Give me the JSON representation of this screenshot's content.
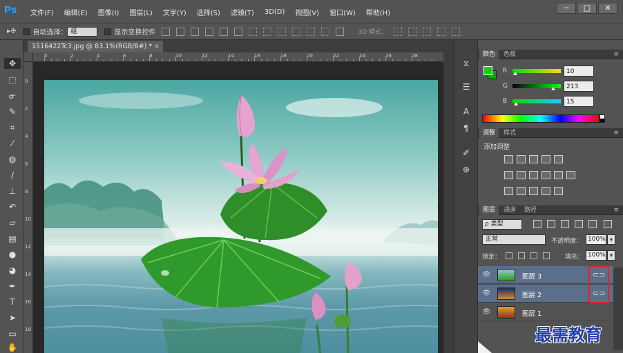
{
  "app": {
    "logo": "Ps"
  },
  "menu": [
    "文件(F)",
    "编辑(E)",
    "图像(I)",
    "图层(L)",
    "文字(Y)",
    "选择(S)",
    "滤镜(T)",
    "3D(D)",
    "视图(V)",
    "窗口(W)",
    "帮助(H)"
  ],
  "window_buttons": {
    "minimize": "−",
    "maximize": "□",
    "close": "✕"
  },
  "options": {
    "move_tool_glyph": "▸✣",
    "auto_select_label": "自动选择：",
    "auto_select_value": "组",
    "show_transform_label": "显示变换控件",
    "mode_3d_label": "3D 模式："
  },
  "document": {
    "tab_title": "1516422Tc3.jpg @ 83.1%(RGB/8#) *",
    "close": "×"
  },
  "ruler_top": [
    "0",
    "2",
    "4",
    "6",
    "8",
    "10",
    "12",
    "14",
    "16",
    "18",
    "20",
    "22",
    "24",
    "26",
    "28"
  ],
  "ruler_left": [
    "0",
    "2",
    "4",
    "6",
    "8",
    "10",
    "12",
    "14",
    "16",
    "18"
  ],
  "color_panel": {
    "tabs": [
      "颜色",
      "色板"
    ],
    "menu": "≡",
    "foreground": "#0ad50f",
    "channels": [
      {
        "label": "R",
        "value": "10",
        "fraction": 0.04
      },
      {
        "label": "G",
        "value": "213",
        "fraction": 0.84
      },
      {
        "label": "B",
        "value": "15",
        "fraction": 0.06
      }
    ]
  },
  "adjust_panel": {
    "tabs": [
      "调整",
      "样式"
    ],
    "menu": "≡",
    "title": "添加调整"
  },
  "layers_panel": {
    "tabs": [
      "图层",
      "通道",
      "路径"
    ],
    "menu": "≡",
    "filter": "ρ 类型",
    "blend_mode": "正常",
    "opacity_label": "不透明度：",
    "opacity": "100%",
    "lock_label": "锁定：",
    "fill_label": "填充：",
    "fill": "100%",
    "layers": [
      {
        "name": "图层 3",
        "selected": true,
        "linked": true
      },
      {
        "name": "图层 2",
        "selected": true,
        "linked": true
      },
      {
        "name": "图层 1",
        "selected": false,
        "linked": false
      }
    ]
  },
  "watermark": "最需教育",
  "icons": {
    "eye": "👁",
    "link": "⊂⊃",
    "dropdown_arrow": "▾"
  }
}
